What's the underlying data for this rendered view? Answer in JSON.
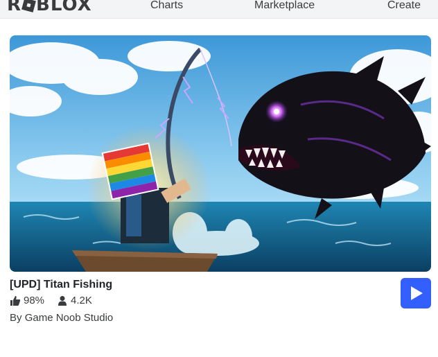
{
  "header": {
    "logo_text": "ROBLOX",
    "nav": [
      {
        "label": "Charts"
      },
      {
        "label": "Marketplace"
      },
      {
        "label": "Create"
      }
    ]
  },
  "game": {
    "title": "[UPD] Titan Fishing",
    "rating": "98%",
    "players": "4.2K",
    "by_label": "By",
    "creator": "Game Noob Studio",
    "thumbnail_icon": "angler-fish-fishing-thumbnail"
  },
  "colors": {
    "play_button": "#335fff",
    "topbar": "#f2f4f5"
  }
}
